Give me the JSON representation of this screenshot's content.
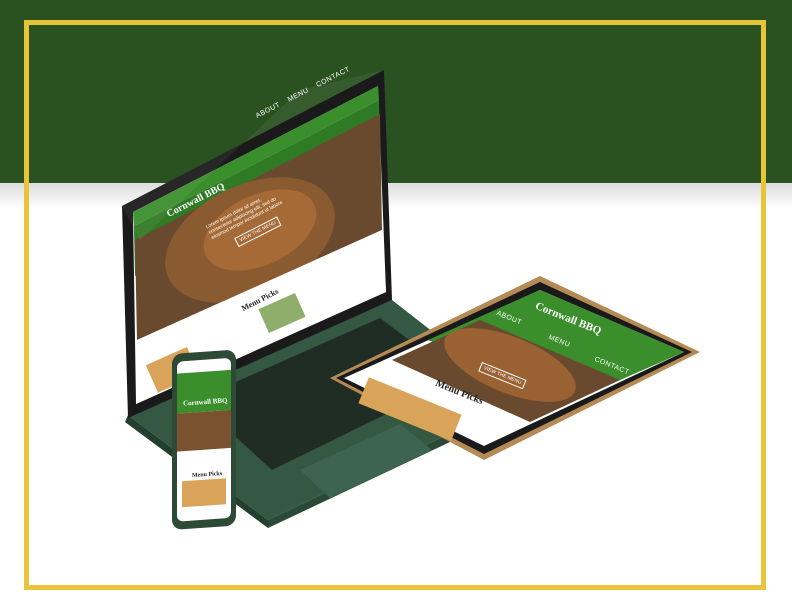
{
  "brand": "Cornwall BBQ",
  "nav": {
    "about": "ABOUT",
    "menu": "MENU",
    "contact": "CONTACT"
  },
  "hero": {
    "line1": "Lorem ipsum dolor sit amet,",
    "line2": "consectetur adipiscing elit, sed do",
    "line3": "eiusmod tempor incididunt ut labore",
    "cta": "VIEW THE MENU"
  },
  "section_title": "Menu Picks",
  "colors": {
    "band": "#2a5221",
    "frame": "#e7c43a",
    "site_green": "#3a8f2c"
  },
  "icons": {
    "logo": "rooster-icon"
  }
}
